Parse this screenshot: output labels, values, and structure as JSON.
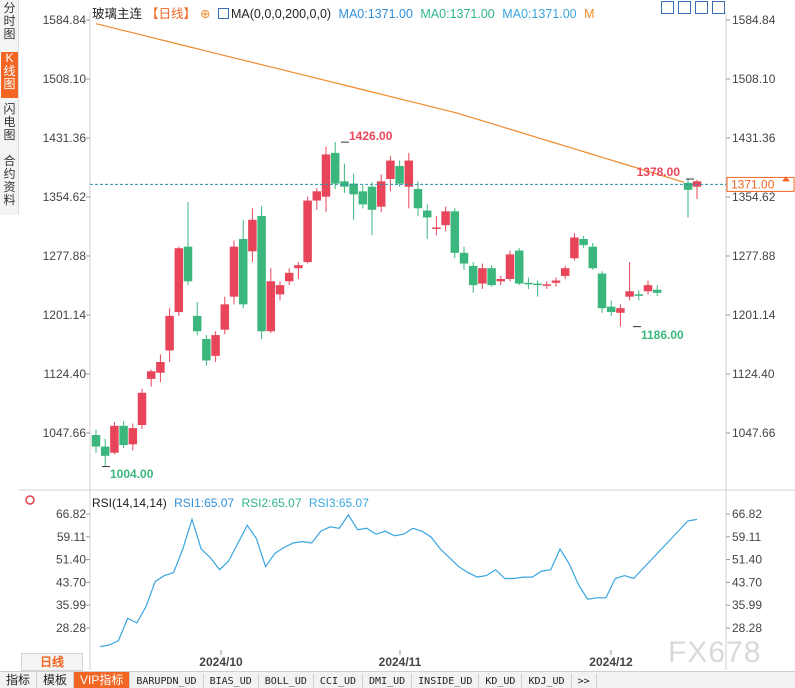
{
  "side_tabs": [
    {
      "label": "分时图",
      "active": false
    },
    {
      "label": "K线图",
      "active": true
    },
    {
      "label": "闪电图",
      "active": false
    },
    {
      "label": "合约资料",
      "active": false
    }
  ],
  "legend": {
    "title": "玻璃主连",
    "period": "【日线】",
    "ma_label": "MA(0,0,0,200,0,0)",
    "ma0": "MA0:1371.00",
    "ma1": "MA0:1371.00",
    "ma2": "MA0:1371.00",
    "m": "M"
  },
  "toolbar_icons": [
    "add-panel-icon",
    "grid-icon",
    "indicator-icon",
    "settings-icon"
  ],
  "colors": {
    "up": "#e8455a",
    "down": "#3bb77e",
    "ma_line": "#f08a2c",
    "rsi_line": "#3aa6e0",
    "last_price_bg": "#f26522",
    "dashed_line": "#2f8fa8",
    "accent": "#f26522"
  },
  "chart_data": [
    {
      "type": "candlestick",
      "title": "玻璃主连",
      "y_ticks": [
        "1584.84",
        "1508.10",
        "1431.36",
        "1354.62",
        "1277.88",
        "1201.14",
        "1124.40",
        "1047.66"
      ],
      "ylim": [
        1000,
        1595
      ],
      "last_price": "1371.00",
      "max_label": "1426.00",
      "min_label": "1186.00",
      "low_label": "1004.00",
      "recent_high_label": "1378.00",
      "x_ticks": [
        "2024/10",
        "2024/11",
        "2024/12"
      ],
      "x_tick_index": [
        16,
        45,
        80
      ],
      "total_slots": 100,
      "candles": [
        {
          "i": 0,
          "o": 1045,
          "h": 1052,
          "l": 1022,
          "c": 1030
        },
        {
          "i": 1,
          "o": 1030,
          "h": 1040,
          "l": 1004,
          "c": 1018
        },
        {
          "i": 2,
          "o": 1022,
          "h": 1062,
          "l": 1020,
          "c": 1057
        },
        {
          "i": 3,
          "o": 1057,
          "h": 1063,
          "l": 1028,
          "c": 1032
        },
        {
          "i": 4,
          "o": 1033,
          "h": 1060,
          "l": 1025,
          "c": 1054
        },
        {
          "i": 5,
          "o": 1058,
          "h": 1105,
          "l": 1053,
          "c": 1100
        },
        {
          "i": 6,
          "o": 1118,
          "h": 1130,
          "l": 1108,
          "c": 1128
        },
        {
          "i": 7,
          "o": 1126,
          "h": 1150,
          "l": 1114,
          "c": 1140
        },
        {
          "i": 8,
          "o": 1155,
          "h": 1210,
          "l": 1140,
          "c": 1200
        },
        {
          "i": 9,
          "o": 1205,
          "h": 1290,
          "l": 1200,
          "c": 1288
        },
        {
          "i": 10,
          "o": 1290,
          "h": 1348,
          "l": 1240,
          "c": 1245
        },
        {
          "i": 11,
          "o": 1200,
          "h": 1218,
          "l": 1175,
          "c": 1180
        },
        {
          "i": 12,
          "o": 1170,
          "h": 1175,
          "l": 1135,
          "c": 1142
        },
        {
          "i": 13,
          "o": 1148,
          "h": 1180,
          "l": 1140,
          "c": 1175
        },
        {
          "i": 14,
          "o": 1182,
          "h": 1225,
          "l": 1176,
          "c": 1215
        },
        {
          "i": 15,
          "o": 1225,
          "h": 1298,
          "l": 1215,
          "c": 1290
        },
        {
          "i": 16,
          "o": 1300,
          "h": 1325,
          "l": 1210,
          "c": 1215
        },
        {
          "i": 17,
          "o": 1284,
          "h": 1340,
          "l": 1270,
          "c": 1325
        },
        {
          "i": 18,
          "o": 1330,
          "h": 1343,
          "l": 1170,
          "c": 1180
        },
        {
          "i": 19,
          "o": 1180,
          "h": 1262,
          "l": 1178,
          "c": 1245
        },
        {
          "i": 20,
          "o": 1228,
          "h": 1245,
          "l": 1220,
          "c": 1240
        },
        {
          "i": 21,
          "o": 1245,
          "h": 1262,
          "l": 1240,
          "c": 1256
        },
        {
          "i": 22,
          "o": 1262,
          "h": 1270,
          "l": 1248,
          "c": 1266
        },
        {
          "i": 23,
          "o": 1270,
          "h": 1355,
          "l": 1268,
          "c": 1350
        },
        {
          "i": 24,
          "o": 1350,
          "h": 1366,
          "l": 1338,
          "c": 1362
        },
        {
          "i": 25,
          "o": 1355,
          "h": 1420,
          "l": 1335,
          "c": 1410
        },
        {
          "i": 26,
          "o": 1412,
          "h": 1426,
          "l": 1365,
          "c": 1372
        },
        {
          "i": 27,
          "o": 1375,
          "h": 1398,
          "l": 1360,
          "c": 1368
        },
        {
          "i": 28,
          "o": 1372,
          "h": 1385,
          "l": 1325,
          "c": 1358
        },
        {
          "i": 29,
          "o": 1362,
          "h": 1370,
          "l": 1340,
          "c": 1345
        },
        {
          "i": 30,
          "o": 1368,
          "h": 1374,
          "l": 1305,
          "c": 1338
        },
        {
          "i": 31,
          "o": 1342,
          "h": 1384,
          "l": 1335,
          "c": 1375
        },
        {
          "i": 32,
          "o": 1378,
          "h": 1408,
          "l": 1362,
          "c": 1402
        },
        {
          "i": 33,
          "o": 1395,
          "h": 1402,
          "l": 1368,
          "c": 1372
        },
        {
          "i": 34,
          "o": 1368,
          "h": 1412,
          "l": 1340,
          "c": 1402
        },
        {
          "i": 35,
          "o": 1365,
          "h": 1375,
          "l": 1330,
          "c": 1340
        },
        {
          "i": 36,
          "o": 1337,
          "h": 1345,
          "l": 1300,
          "c": 1328
        },
        {
          "i": 37,
          "o": 1315,
          "h": 1330,
          "l": 1305,
          "c": 1315
        },
        {
          "i": 38,
          "o": 1318,
          "h": 1342,
          "l": 1310,
          "c": 1336
        },
        {
          "i": 39,
          "o": 1336,
          "h": 1340,
          "l": 1275,
          "c": 1282
        },
        {
          "i": 40,
          "o": 1282,
          "h": 1290,
          "l": 1260,
          "c": 1268
        },
        {
          "i": 41,
          "o": 1265,
          "h": 1270,
          "l": 1230,
          "c": 1240
        },
        {
          "i": 42,
          "o": 1242,
          "h": 1268,
          "l": 1235,
          "c": 1262
        },
        {
          "i": 43,
          "o": 1262,
          "h": 1266,
          "l": 1238,
          "c": 1240
        },
        {
          "i": 44,
          "o": 1245,
          "h": 1252,
          "l": 1240,
          "c": 1248
        },
        {
          "i": 45,
          "o": 1248,
          "h": 1285,
          "l": 1245,
          "c": 1280
        },
        {
          "i": 46,
          "o": 1285,
          "h": 1288,
          "l": 1240,
          "c": 1242
        },
        {
          "i": 47,
          "o": 1243,
          "h": 1250,
          "l": 1235,
          "c": 1241
        },
        {
          "i": 48,
          "o": 1242,
          "h": 1246,
          "l": 1225,
          "c": 1240
        },
        {
          "i": 49,
          "o": 1240,
          "h": 1245,
          "l": 1235,
          "c": 1241
        },
        {
          "i": 50,
          "o": 1243,
          "h": 1250,
          "l": 1238,
          "c": 1246
        },
        {
          "i": 51,
          "o": 1252,
          "h": 1265,
          "l": 1248,
          "c": 1262
        },
        {
          "i": 52,
          "o": 1275,
          "h": 1308,
          "l": 1272,
          "c": 1302
        },
        {
          "i": 53,
          "o": 1300,
          "h": 1304,
          "l": 1288,
          "c": 1292
        },
        {
          "i": 54,
          "o": 1290,
          "h": 1295,
          "l": 1260,
          "c": 1262
        },
        {
          "i": 55,
          "o": 1255,
          "h": 1258,
          "l": 1204,
          "c": 1210
        },
        {
          "i": 56,
          "o": 1212,
          "h": 1220,
          "l": 1200,
          "c": 1205
        },
        {
          "i": 57,
          "o": 1204,
          "h": 1215,
          "l": 1186,
          "c": 1210
        },
        {
          "i": 58,
          "o": 1225,
          "h": 1270,
          "l": 1220,
          "c": 1232
        },
        {
          "i": 59,
          "o": 1228,
          "h": 1233,
          "l": 1220,
          "c": 1226
        },
        {
          "i": 60,
          "o": 1232,
          "h": 1246,
          "l": 1228,
          "c": 1240
        },
        {
          "i": 61,
          "o": 1234,
          "h": 1240,
          "l": 1226,
          "c": 1230
        },
        {
          "i": 62,
          "o": 1373,
          "h": 1378,
          "l": 1328,
          "c": 1364
        },
        {
          "i": 63,
          "o": 1368,
          "h": 1377,
          "l": 1352,
          "c": 1375
        }
      ],
      "candle_slots": [
        0,
        1,
        2,
        3,
        4,
        5,
        6,
        7,
        8,
        9,
        10,
        11,
        12,
        13,
        14,
        15,
        16,
        17,
        18,
        19,
        20,
        21,
        22,
        23,
        24,
        25,
        26,
        27,
        28,
        29,
        30,
        31,
        32,
        33,
        34,
        35,
        36,
        37,
        38,
        39,
        40,
        41,
        42,
        43,
        44,
        45,
        46,
        47,
        48,
        49,
        50,
        51,
        52,
        53,
        54,
        55,
        56,
        57,
        58,
        59,
        60,
        61,
        62,
        63
      ]
    },
    {
      "type": "line",
      "name": "RSI(14,14,14)",
      "y_ticks": [
        "66.82",
        "59.11",
        "51.40",
        "43.70",
        "35.99",
        "28.28"
      ],
      "ylim": [
        22,
        68
      ],
      "values": [
        22.0,
        22.5,
        24.0,
        31.5,
        30.0,
        35.5,
        44.0,
        46.0,
        47.0,
        55.0,
        65.0,
        55.0,
        52.0,
        48.0,
        51.0,
        57.0,
        63.0,
        58.5,
        49.0,
        53.5,
        55.5,
        57.0,
        57.5,
        57.0,
        61.0,
        62.5,
        62.0,
        66.5,
        61.5,
        62.0,
        60.0,
        61.0,
        59.5,
        60.0,
        62.0,
        61.0,
        59.0,
        55.0,
        52.0,
        49.0,
        47.0,
        45.5,
        46.0,
        48.0,
        45.0,
        45.0,
        45.5,
        45.5,
        47.5,
        48.0,
        55.0,
        50.0,
        43.0,
        38.0,
        38.5,
        38.5,
        45.0,
        46.0,
        45.0,
        64.5,
        65.0
      ]
    }
  ],
  "rsi_legend": {
    "main": "RSI(14,14,14)",
    "rsi1": "RSI1:65.07",
    "rsi2": "RSI2:65.07",
    "rsi3": "RSI3:65.07"
  },
  "period_button": "日线",
  "bottom_tabs": [
    {
      "label": "指标",
      "active": false
    },
    {
      "label": "模板",
      "active": false
    },
    {
      "label": "VIP指标",
      "active": true
    },
    {
      "label": "BARUPDN_UD",
      "active": false
    },
    {
      "label": "BIAS_UD",
      "active": false
    },
    {
      "label": "BOLL_UD",
      "active": false
    },
    {
      "label": "CCI_UD",
      "active": false
    },
    {
      "label": "DMI_UD",
      "active": false
    },
    {
      "label": "INSIDE_UD",
      "active": false
    },
    {
      "label": "KD_UD",
      "active": false
    },
    {
      "label": "KDJ_UD",
      "active": false
    },
    {
      "label": ">>",
      "active": false
    }
  ],
  "watermark": "FX678"
}
